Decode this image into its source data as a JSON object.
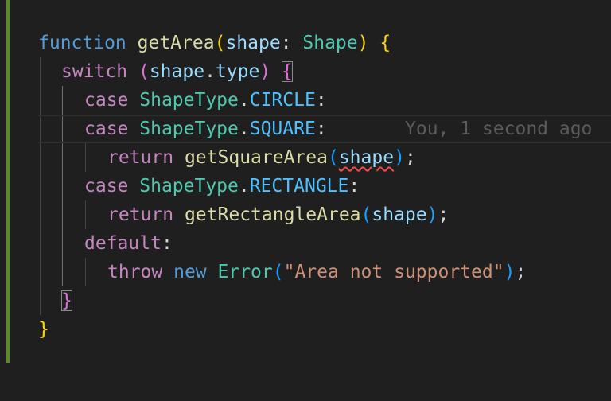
{
  "editor": {
    "blame_annotation": "You, 1 second ago",
    "lines": [
      {
        "tokens": [
          "function",
          "getArea",
          "(",
          "shape",
          ": ",
          "Shape",
          ")",
          " ",
          "{"
        ]
      },
      {
        "tokens": [
          "switch",
          " ",
          "(",
          "shape",
          ".",
          "type",
          ")",
          " ",
          "{"
        ]
      },
      {
        "tokens": [
          "case",
          " ",
          "ShapeType",
          ".",
          "CIRCLE",
          ":"
        ]
      },
      {
        "tokens": [
          "case",
          " ",
          "ShapeType",
          ".",
          "SQUARE",
          ":"
        ]
      },
      {
        "tokens": [
          "return",
          " ",
          "getSquareArea",
          "(",
          "shape",
          ")",
          ";"
        ]
      },
      {
        "tokens": [
          "case",
          " ",
          "ShapeType",
          ".",
          "RECTANGLE",
          ":"
        ]
      },
      {
        "tokens": [
          "return",
          " ",
          "getRectangleArea",
          "(",
          "shape",
          ")",
          ";"
        ]
      },
      {
        "tokens": [
          "default",
          ":"
        ]
      },
      {
        "tokens": [
          "throw",
          " ",
          "new",
          " ",
          "Error",
          "(",
          "\"Area not supported\"",
          ")",
          ";"
        ]
      },
      {
        "tokens": [
          "}"
        ]
      },
      {
        "tokens": [
          "}"
        ]
      }
    ]
  },
  "colors": {
    "background": "#1f1f1f",
    "git_gutter_modified": "#5a8a2a",
    "keyword_blue": "#569cd6",
    "keyword_control": "#c586c0",
    "function": "#dcdcaa",
    "variable": "#9cdcfe",
    "type": "#4ec9b0",
    "constant": "#4fc1ff",
    "string": "#ce9178",
    "error_squiggle": "#f14c4c"
  }
}
